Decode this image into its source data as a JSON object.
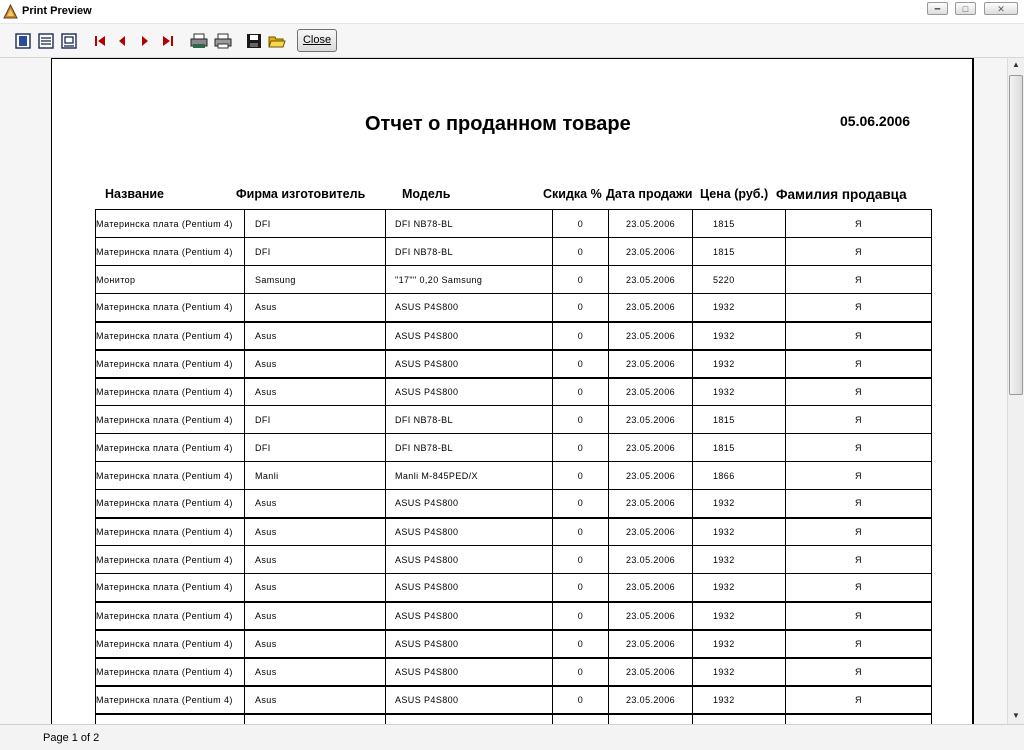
{
  "window": {
    "title": "Print Preview"
  },
  "toolbar": {
    "close_label": "Close"
  },
  "report": {
    "title": "Отчет о проданном товаре",
    "date": "05.06.2006",
    "columns": [
      "Название",
      "Фирма изготовитель",
      "Модель",
      "Скидка %",
      "Дата продажи",
      "Цена (руб.)",
      "Фамилия продавца"
    ],
    "rows": [
      [
        "Материнска плата (Pentium 4)",
        "DFI",
        "DFI NB78-BL",
        "0",
        "23.05.2006",
        "1815",
        "Я"
      ],
      [
        "Материнска плата (Pentium 4)",
        "DFI",
        "DFI NB78-BL",
        "0",
        "23.05.2006",
        "1815",
        "Я"
      ],
      [
        "Монитор",
        "Samsung",
        "\"17\"\" 0,20 Samsung",
        "0",
        "23.05.2006",
        "5220",
        "Я"
      ],
      [
        "Материнска плата (Pentium 4)",
        "Asus",
        "ASUS P4S800",
        "0",
        "23.05.2006",
        "1932",
        "Я"
      ],
      [
        "Материнска плата (Pentium 4)",
        "Asus",
        "ASUS P4S800",
        "0",
        "23.05.2006",
        "1932",
        "Я"
      ],
      [
        "Материнска плата (Pentium 4)",
        "Asus",
        "ASUS P4S800",
        "0",
        "23.05.2006",
        "1932",
        "Я"
      ],
      [
        "Материнска плата (Pentium 4)",
        "Asus",
        "ASUS P4S800",
        "0",
        "23.05.2006",
        "1932",
        "Я"
      ],
      [
        "Материнска плата (Pentium 4)",
        "DFI",
        "DFI NB78-BL",
        "0",
        "23.05.2006",
        "1815",
        "Я"
      ],
      [
        "Материнска плата (Pentium 4)",
        "DFI",
        "DFI NB78-BL",
        "0",
        "23.05.2006",
        "1815",
        "Я"
      ],
      [
        "Материнска плата (Pentium 4)",
        "Manli",
        "Manli M-845PED/X",
        "0",
        "23.05.2006",
        "1866",
        "Я"
      ],
      [
        "Материнска плата (Pentium 4)",
        "Asus",
        "ASUS P4S800",
        "0",
        "23.05.2006",
        "1932",
        "Я"
      ],
      [
        "Материнска плата (Pentium 4)",
        "Asus",
        "ASUS P4S800",
        "0",
        "23.05.2006",
        "1932",
        "Я"
      ],
      [
        "Материнска плата (Pentium 4)",
        "Asus",
        "ASUS P4S800",
        "0",
        "23.05.2006",
        "1932",
        "Я"
      ],
      [
        "Материнска плата (Pentium 4)",
        "Asus",
        "ASUS P4S800",
        "0",
        "23.05.2006",
        "1932",
        "Я"
      ],
      [
        "Материнска плата (Pentium 4)",
        "Asus",
        "ASUS P4S800",
        "0",
        "23.05.2006",
        "1932",
        "Я"
      ],
      [
        "Материнска плата (Pentium 4)",
        "Asus",
        "ASUS P4S800",
        "0",
        "23.05.2006",
        "1932",
        "Я"
      ],
      [
        "Материнска плата (Pentium 4)",
        "Asus",
        "ASUS P4S800",
        "0",
        "23.05.2006",
        "1932",
        "Я"
      ],
      [
        "Материнска плата (Pentium 4)",
        "Asus",
        "ASUS P4S800",
        "0",
        "23.05.2006",
        "1932",
        "Я"
      ],
      [
        "",
        "",
        "",
        "",
        "",
        "",
        ""
      ]
    ]
  },
  "status": {
    "page_text": "Page 1 of 2"
  }
}
